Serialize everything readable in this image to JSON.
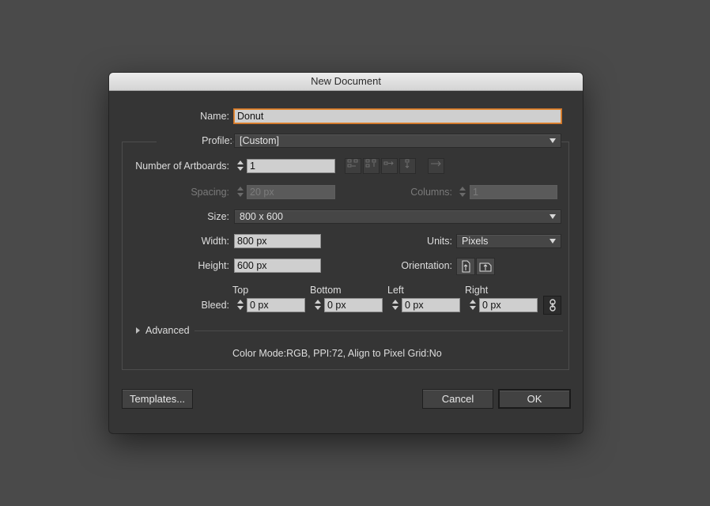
{
  "dialog": {
    "title": "New Document"
  },
  "name": {
    "label": "Name:",
    "value": "Donut"
  },
  "profile": {
    "label": "Profile:",
    "value": "[Custom]"
  },
  "artboards": {
    "label": "Number of Artboards:",
    "value": "1"
  },
  "spacing": {
    "label": "Spacing:",
    "value": "20 px"
  },
  "columns": {
    "label": "Columns:",
    "value": "1"
  },
  "size": {
    "label": "Size:",
    "value": "800 x 600"
  },
  "width": {
    "label": "Width:",
    "value": "800 px"
  },
  "units": {
    "label": "Units:",
    "value": "Pixels"
  },
  "height": {
    "label": "Height:",
    "value": "600 px"
  },
  "orientation": {
    "label": "Orientation:"
  },
  "bleed": {
    "label": "Bleed:",
    "top_label": "Top",
    "top": "0 px",
    "bottom_label": "Bottom",
    "bottom": "0 px",
    "left_label": "Left",
    "left": "0 px",
    "right_label": "Right",
    "right": "0 px"
  },
  "advanced": {
    "label": "Advanced"
  },
  "summary": "Color Mode:RGB, PPI:72, Align to Pixel Grid:No",
  "buttons": {
    "templates": "Templates...",
    "cancel": "Cancel",
    "ok": "OK"
  },
  "colors": {
    "focus": "#e38a33",
    "dialog_bg": "#353535",
    "backdrop": "#4a4a4a"
  }
}
